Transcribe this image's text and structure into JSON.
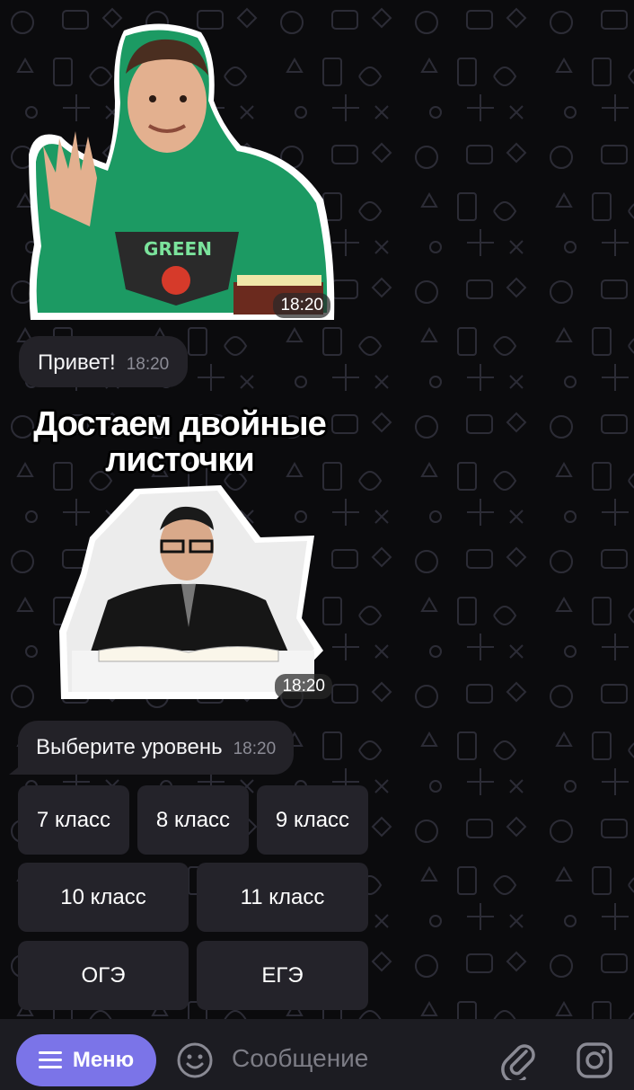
{
  "chat": {
    "messages": [
      {
        "type": "sticker",
        "time": "18:20"
      },
      {
        "type": "text",
        "text": "Привет!",
        "time": "18:20"
      },
      {
        "type": "sticker",
        "caption_line1": "Достаем двойные",
        "caption_line2": "листочки",
        "time": "18:20"
      },
      {
        "type": "text",
        "text": "Выберите уровень",
        "time": "18:20"
      }
    ]
  },
  "keyboard": {
    "rows": [
      [
        "7 класс",
        "8 класс",
        "9 класс"
      ],
      [
        "10 класс",
        "11 класс"
      ],
      [
        "ОГЭ",
        "ЕГЭ"
      ]
    ]
  },
  "input_bar": {
    "menu_label": "Меню",
    "menu_icon": "hamburger-icon",
    "emoji_icon": "emoji-icon",
    "placeholder": "Сообщение",
    "attach_icon": "paperclip-icon",
    "camera_icon": "instagram-camera-icon"
  },
  "colors": {
    "background": "#0b0b0d",
    "bubble": "#232228",
    "keyboard_button": "#24232a",
    "input_bar": "#1c1c22",
    "accent": "#7b74e8"
  }
}
